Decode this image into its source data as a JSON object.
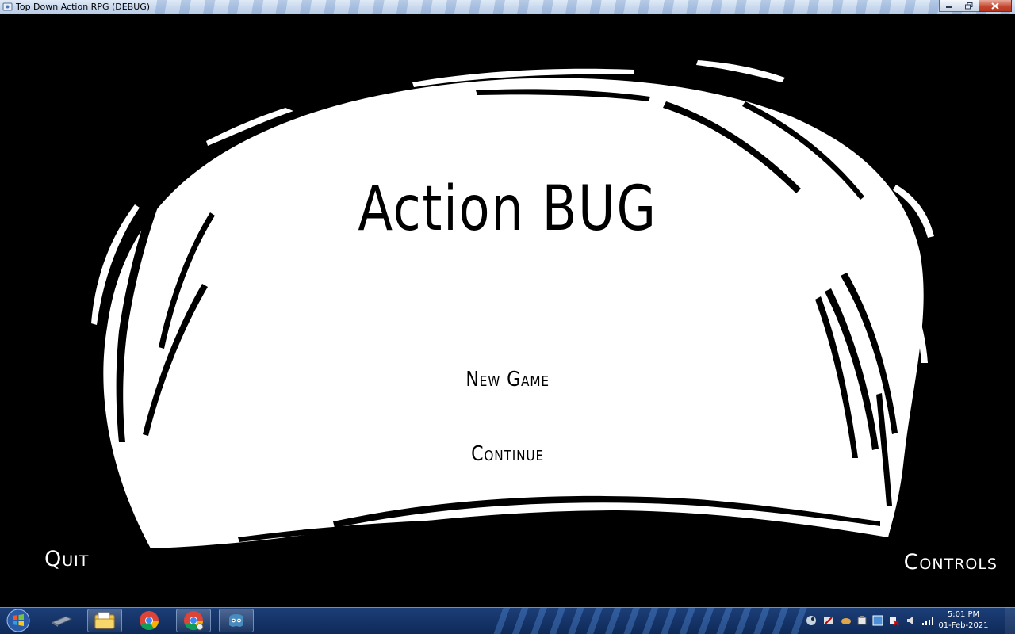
{
  "window": {
    "title": "Top Down Action RPG (DEBUG)"
  },
  "game": {
    "title": "Action BUG",
    "menu": {
      "new_game": "New Game",
      "continue": "Continue",
      "quit": "Quit",
      "controls": "Controls"
    }
  },
  "taskbar": {
    "pinned": [
      "explorer-icon",
      "chrome-icon",
      "chrome-user-icon",
      "godot-icon"
    ],
    "clock": {
      "time": "5:01 PM",
      "date": "01-Feb-2021"
    }
  },
  "colors": {
    "background": "#000000",
    "blob": "#ffffff",
    "taskbar": "#16356a"
  }
}
